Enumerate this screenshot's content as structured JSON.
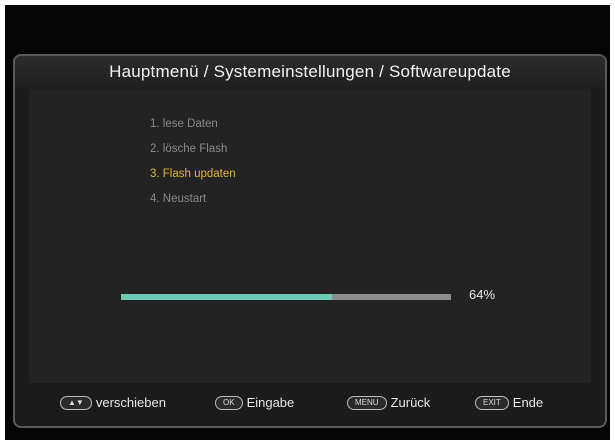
{
  "title": "Hauptmenü / Systemeinstellungen / Softwareupdate",
  "steps": [
    {
      "label": "1. lese Daten",
      "state": "done"
    },
    {
      "label": "2. lösche Flash",
      "state": "done"
    },
    {
      "label": "3. Flash updaten",
      "state": "active"
    },
    {
      "label": "4. Neustart",
      "state": "pending"
    }
  ],
  "progress": {
    "value": 0.64,
    "text": "64%"
  },
  "footer": {
    "move": {
      "key": "▲▼",
      "label": "verschieben"
    },
    "ok": {
      "key": "OK",
      "label": "Eingabe"
    },
    "menu": {
      "key": "MENU",
      "label": "Zurück"
    },
    "exit": {
      "key": "EXIT",
      "label": "Ende"
    }
  },
  "colors": {
    "accent": "#e2b43b",
    "progress_fill": "#6ec9b6",
    "progress_track": "#8d8d8d"
  }
}
